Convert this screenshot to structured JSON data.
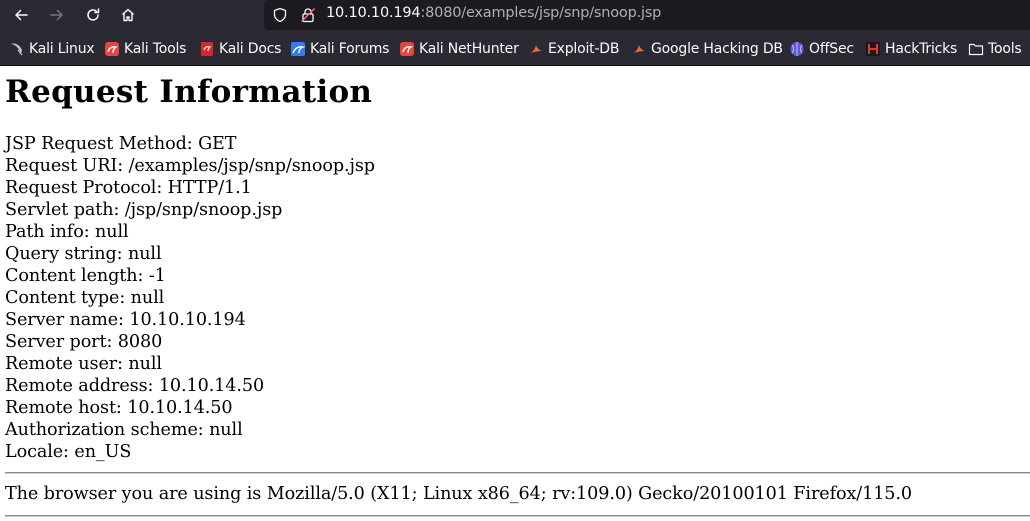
{
  "browser": {
    "url_host": "10.10.10.194",
    "url_rest": ":8080/examples/jsp/snp/snoop.jsp",
    "icons": {
      "back": "arrow-left-icon",
      "forward": "arrow-right-icon",
      "reload": "reload-icon",
      "home": "home-icon",
      "shield": "shield-icon",
      "lock": "insecure-lock-icon"
    },
    "colors": {
      "toolbar": "#2b2a33",
      "urlbar": "#1c1b22",
      "text": "#fbfbfe"
    }
  },
  "bookmarks": [
    {
      "label": "Kali Linux",
      "icon": "kali-dragon-icon"
    },
    {
      "label": "Kali Tools",
      "icon": "kali-red-icon"
    },
    {
      "label": "Kali Docs",
      "icon": "kali-docs-icon"
    },
    {
      "label": "Kali Forums",
      "icon": "kali-forums-icon"
    },
    {
      "label": "Kali NetHunter",
      "icon": "kali-red-icon"
    },
    {
      "label": "Exploit-DB",
      "icon": "exploit-db-icon"
    },
    {
      "label": "Google Hacking DB",
      "icon": "exploit-db-icon"
    },
    {
      "label": "OffSec",
      "icon": "offsec-icon"
    },
    {
      "label": "HackTricks",
      "icon": "hacktricks-icon"
    },
    {
      "label": "Tools",
      "icon": "folder-icon"
    }
  ],
  "page": {
    "title": "Request Information",
    "lines": [
      "JSP Request Method: GET",
      "Request URI: /examples/jsp/snp/snoop.jsp",
      "Request Protocol: HTTP/1.1",
      "Servlet path: /jsp/snp/snoop.jsp",
      "Path info: null",
      "Query string: null",
      "Content length: -1",
      "Content type: null",
      "Server name: 10.10.10.194",
      "Server port: 8080",
      "Remote user: null",
      "Remote address: 10.10.14.50",
      "Remote host: 10.10.14.50",
      "Authorization scheme: null",
      "Locale: en_US"
    ],
    "browser_info": "The browser you are using is Mozilla/5.0 (X11; Linux x86_64; rv:109.0) Gecko/20100101 Firefox/115.0"
  }
}
